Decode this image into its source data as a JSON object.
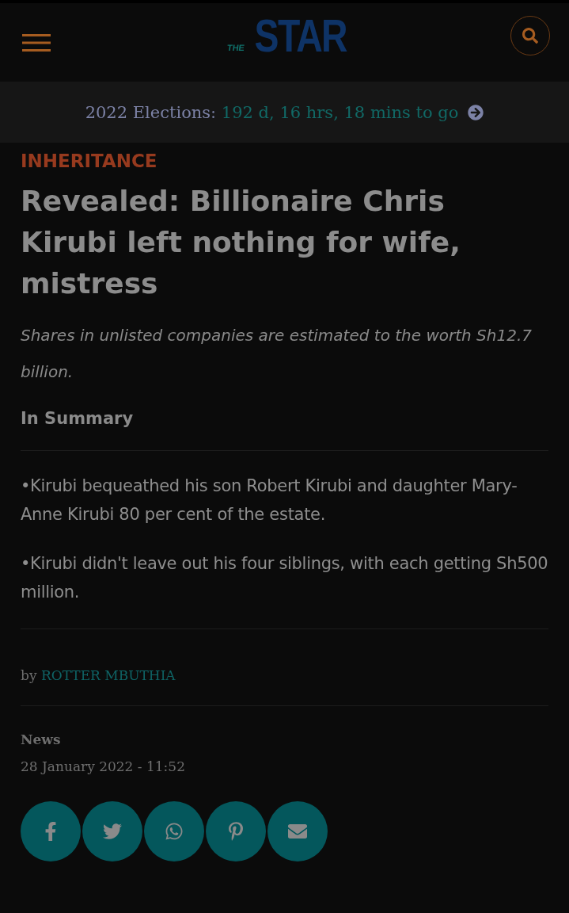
{
  "header": {
    "logo": {
      "small": "THE",
      "main": "STAR"
    }
  },
  "countdown": {
    "label": "2022 Elections:",
    "value": "192 d, 16 hrs, 18 mins to go"
  },
  "article": {
    "category": "INHERITANCE",
    "headline": "Revealed: Billionaire Chris Kirubi left nothing for wife, mistress",
    "standfirst": "Shares in unlisted companies are estimated to the worth Sh12.7 billion.",
    "summary_title": "In Summary",
    "summary": [
      "•Kirubi bequeathed his son Robert Kirubi and daughter Mary-Anne Kirubi 80 per cent of the estate.",
      "•Kirubi didn't leave out his four siblings, with each getting Sh500 million."
    ],
    "byline": {
      "prefix": "by",
      "author": "ROTTER MBUTHIA"
    },
    "section": "News",
    "date": "28 January 2022 - 11:52"
  },
  "share_buttons": [
    {
      "kind": "facebook"
    },
    {
      "kind": "twitter"
    },
    {
      "kind": "whatsapp"
    },
    {
      "kind": "pinterest"
    },
    {
      "kind": "email"
    }
  ]
}
